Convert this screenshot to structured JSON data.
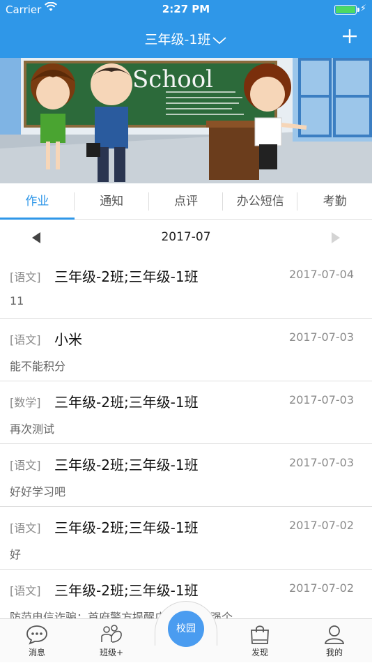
{
  "status_bar": {
    "carrier": "Carrier",
    "time": "2:27 PM",
    "battery_level": 1.0
  },
  "nav": {
    "title": "三年级-1班",
    "icons": {
      "dropdown": "chevron-down-icon",
      "add": "plus-icon"
    }
  },
  "banner": {
    "board_text": "School"
  },
  "tabs": [
    {
      "label": "作业",
      "active": true
    },
    {
      "label": "通知",
      "active": false
    },
    {
      "label": "点评",
      "active": false
    },
    {
      "label": "办公短信",
      "active": false
    },
    {
      "label": "考勤",
      "active": false
    }
  ],
  "month": {
    "label": "2017-07"
  },
  "items": [
    {
      "subject": "[语文]",
      "classes": "三年级-2班;三年级-1班",
      "date": "2017-07-04",
      "content": "11"
    },
    {
      "subject": "[语文]",
      "classes": "小米",
      "date": "2017-07-03",
      "content": "能不能积分"
    },
    {
      "subject": "[数学]",
      "classes": "三年级-2班;三年级-1班",
      "date": "2017-07-03",
      "content": "再次测试"
    },
    {
      "subject": "[语文]",
      "classes": "三年级-2班;三年级-1班",
      "date": "2017-07-03",
      "content": "好好学习吧"
    },
    {
      "subject": "[语文]",
      "classes": "三年级-2班;三年级-1班",
      "date": "2017-07-02",
      "content": "好"
    },
    {
      "subject": "[语文]",
      "classes": "三年级-2班;三年级-1班",
      "date": "2017-07-02",
      "content": "防范电信诈骗：首府警方提醒广大市民加强个"
    }
  ],
  "tabbar": {
    "messages": "消息",
    "class_plus": "班级+",
    "campus": "校园",
    "discover": "发现",
    "mine": "我的"
  },
  "colors": {
    "accent": "#2f97e8",
    "battery": "#4cd964",
    "campus_button": "#4a9cf0"
  }
}
